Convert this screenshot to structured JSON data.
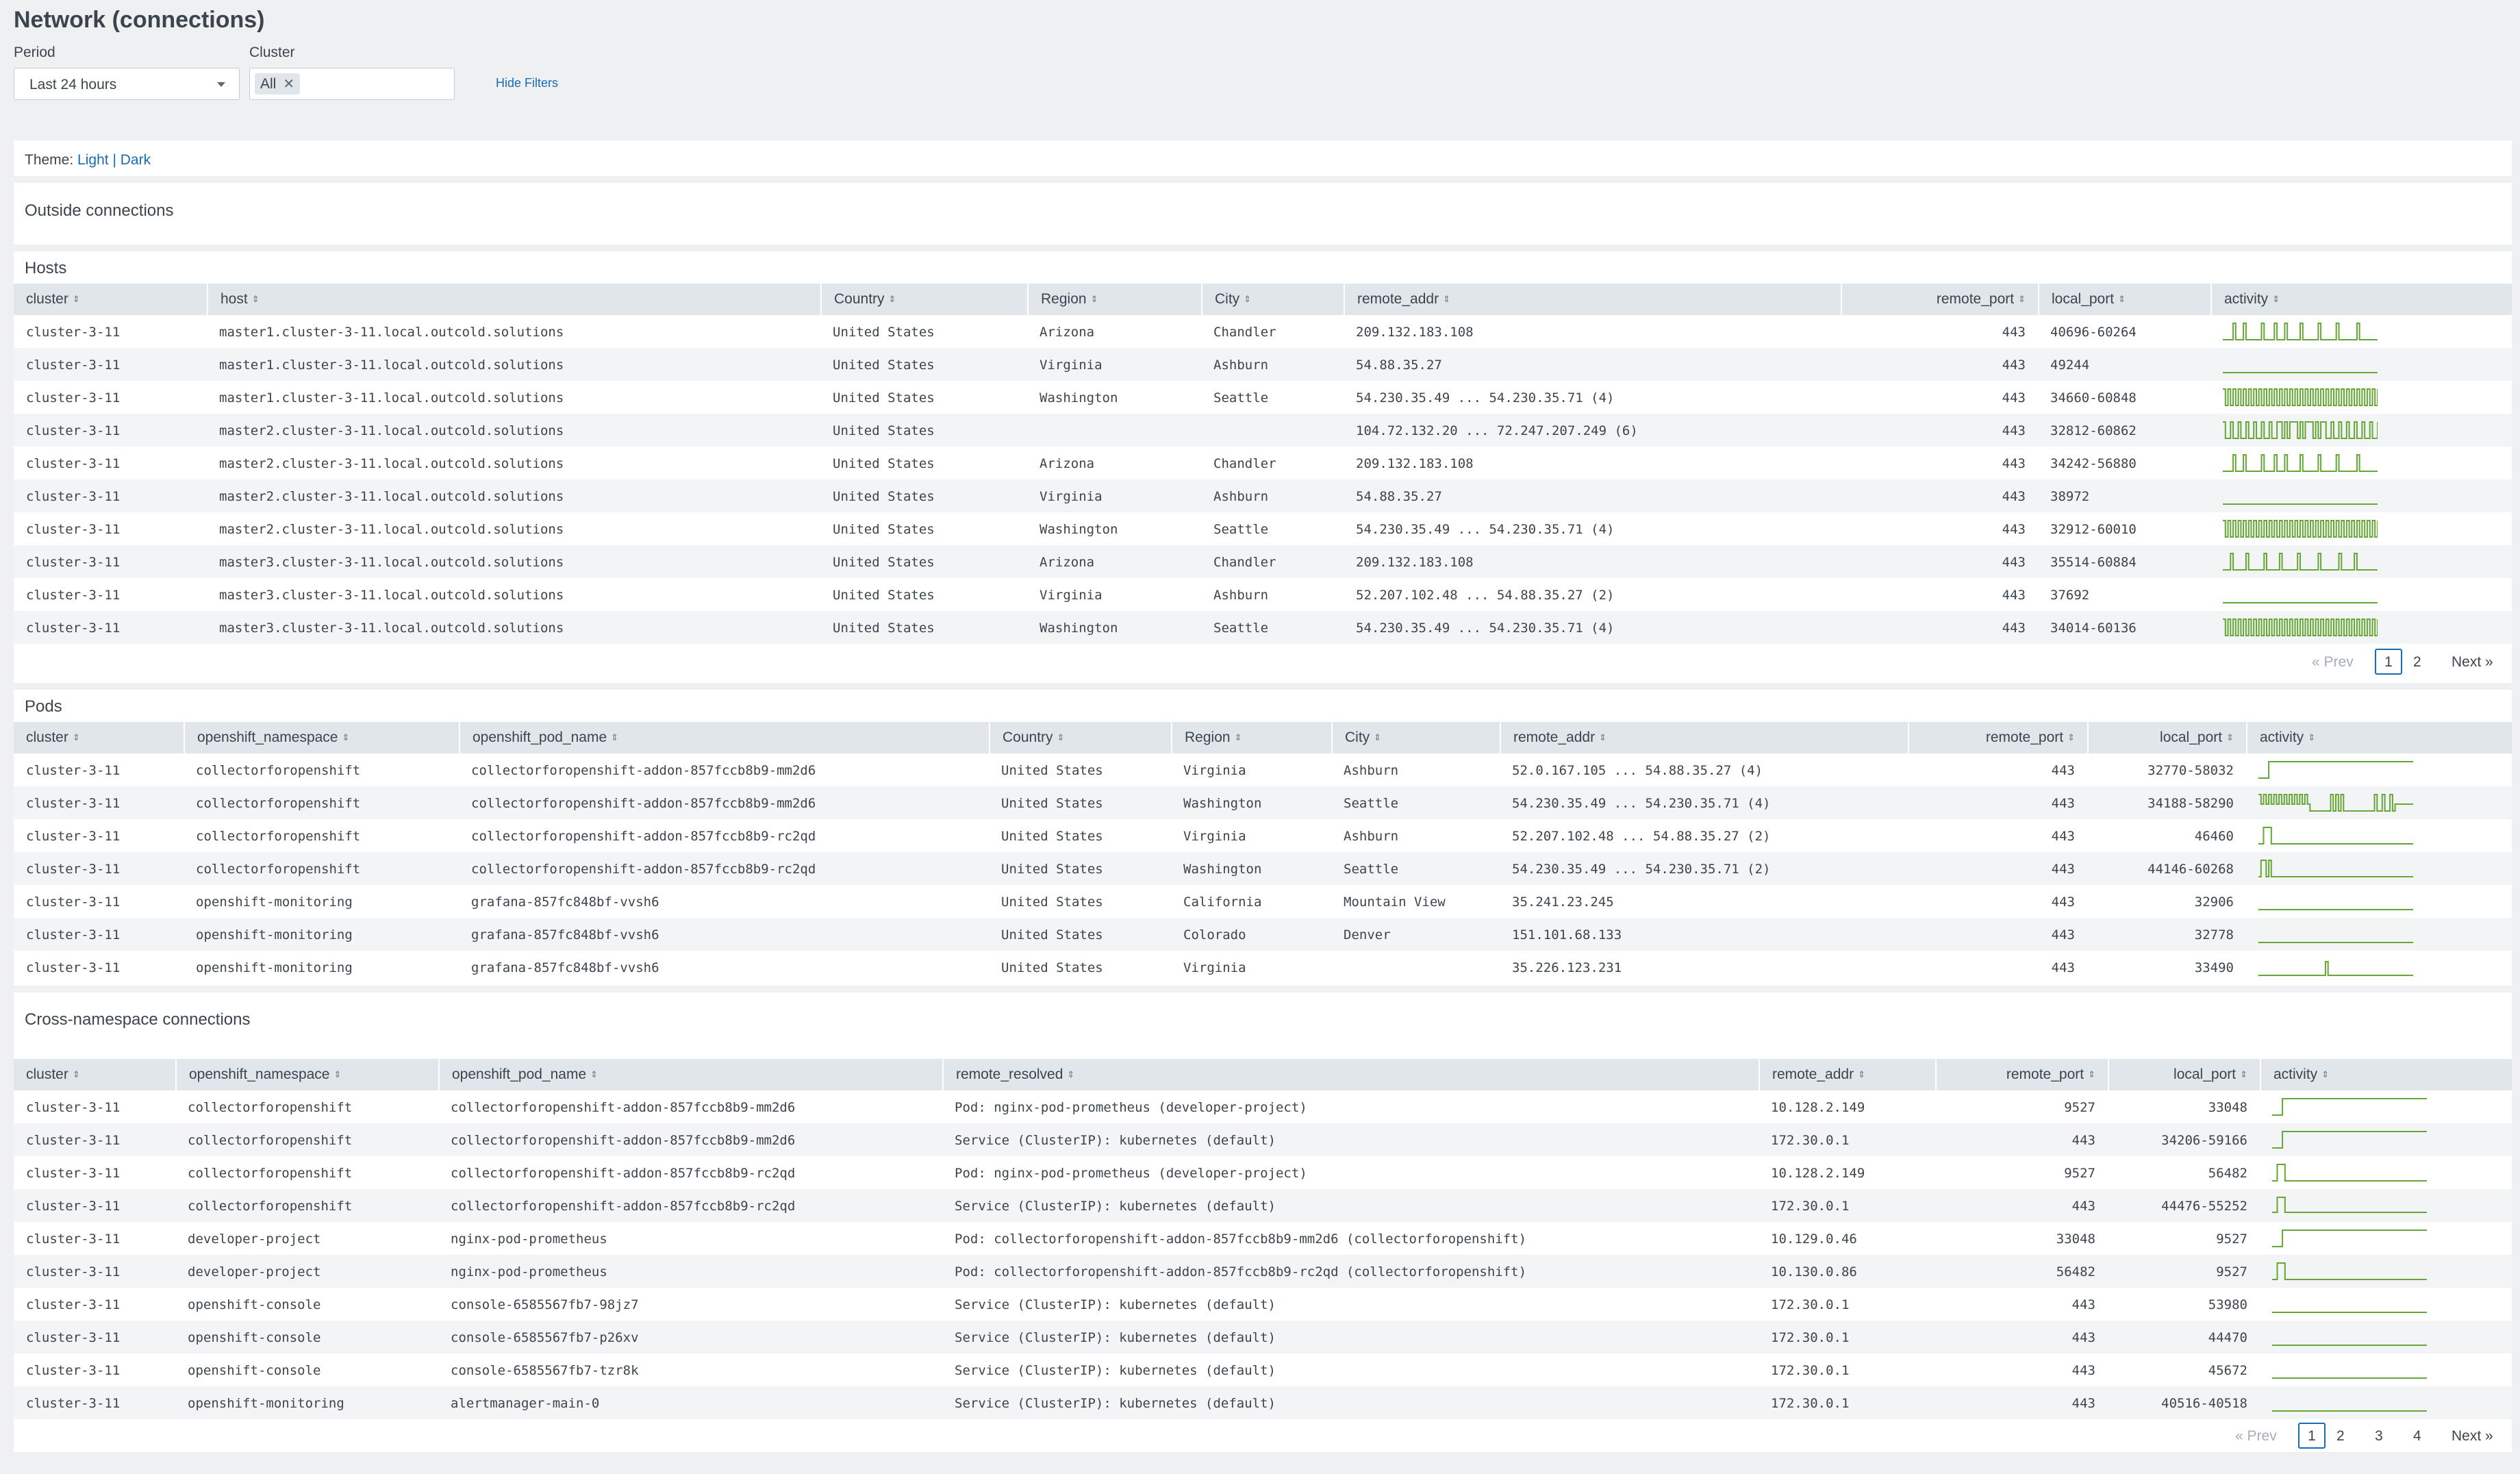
{
  "page_title": "Network (connections)",
  "filters": {
    "period_label": "Period",
    "period_value": "Last 24 hours",
    "cluster_label": "Cluster",
    "cluster_chip": "All",
    "hide_filters": "Hide Filters"
  },
  "theme": {
    "label": "Theme:",
    "light": "Light",
    "separator": "|",
    "dark": "Dark"
  },
  "outside_title": "Outside connections",
  "colors": {
    "accent": "#1a6bb0",
    "sparkline": "#65a637",
    "header_bg": "#e1e6eb"
  },
  "hosts": {
    "title": "Hosts",
    "columns": [
      "cluster",
      "host",
      "Country",
      "Region",
      "City",
      "remote_addr",
      "remote_port",
      "local_port",
      "activity"
    ],
    "rows": [
      [
        "cluster-3-11",
        "master1.cluster-3-11.local.outcold.solutions",
        "United States",
        "Arizona",
        "Chandler",
        "209.132.183.108",
        "443",
        "40696-60264"
      ],
      [
        "cluster-3-11",
        "master1.cluster-3-11.local.outcold.solutions",
        "United States",
        "Virginia",
        "Ashburn",
        "54.88.35.27",
        "443",
        "49244"
      ],
      [
        "cluster-3-11",
        "master1.cluster-3-11.local.outcold.solutions",
        "United States",
        "Washington",
        "Seattle",
        "54.230.35.49 ... 54.230.35.71 (4)",
        "443",
        "34660-60848"
      ],
      [
        "cluster-3-11",
        "master2.cluster-3-11.local.outcold.solutions",
        "United States",
        "",
        "",
        "104.72.132.20 ... 72.247.207.249 (6)",
        "443",
        "32812-60862"
      ],
      [
        "cluster-3-11",
        "master2.cluster-3-11.local.outcold.solutions",
        "United States",
        "Arizona",
        "Chandler",
        "209.132.183.108",
        "443",
        "34242-56880"
      ],
      [
        "cluster-3-11",
        "master2.cluster-3-11.local.outcold.solutions",
        "United States",
        "Virginia",
        "Ashburn",
        "54.88.35.27",
        "443",
        "38972"
      ],
      [
        "cluster-3-11",
        "master2.cluster-3-11.local.outcold.solutions",
        "United States",
        "Washington",
        "Seattle",
        "54.230.35.49 ... 54.230.35.71 (4)",
        "443",
        "32912-60010"
      ],
      [
        "cluster-3-11",
        "master3.cluster-3-11.local.outcold.solutions",
        "United States",
        "Arizona",
        "Chandler",
        "209.132.183.108",
        "443",
        "35514-60884"
      ],
      [
        "cluster-3-11",
        "master3.cluster-3-11.local.outcold.solutions",
        "United States",
        "Virginia",
        "Ashburn",
        "52.207.102.48 ... 54.88.35.27 (2)",
        "443",
        "37692"
      ],
      [
        "cluster-3-11",
        "master3.cluster-3-11.local.outcold.solutions",
        "United States",
        "Washington",
        "Seattle",
        "54.230.35.49 ... 54.230.35.71 (4)",
        "443",
        "34014-60136"
      ]
    ],
    "activity": [
      "pulses",
      "flat",
      "dense",
      "sparse",
      "pulses",
      "flat",
      "dense",
      "pulses2",
      "flat",
      "dense"
    ],
    "pager": {
      "prev": "« Prev",
      "pages": [
        "1",
        "2"
      ],
      "current": "1",
      "next": "Next »"
    }
  },
  "pods": {
    "title": "Pods",
    "columns": [
      "cluster",
      "openshift_namespace",
      "openshift_pod_name",
      "Country",
      "Region",
      "City",
      "remote_addr",
      "remote_port",
      "local_port",
      "activity"
    ],
    "rows": [
      [
        "cluster-3-11",
        "collectorforopenshift",
        "collectorforopenshift-addon-857fccb8b9-mm2d6",
        "United States",
        "Virginia",
        "Ashburn",
        "52.0.167.105 ... 54.88.35.27 (4)",
        "443",
        "32770-58032"
      ],
      [
        "cluster-3-11",
        "collectorforopenshift",
        "collectorforopenshift-addon-857fccb8b9-mm2d6",
        "United States",
        "Washington",
        "Seattle",
        "54.230.35.49 ... 54.230.35.71 (4)",
        "443",
        "34188-58290"
      ],
      [
        "cluster-3-11",
        "collectorforopenshift",
        "collectorforopenshift-addon-857fccb8b9-rc2qd",
        "United States",
        "Virginia",
        "Ashburn",
        "52.207.102.48 ... 54.88.35.27 (2)",
        "443",
        "46460"
      ],
      [
        "cluster-3-11",
        "collectorforopenshift",
        "collectorforopenshift-addon-857fccb8b9-rc2qd",
        "United States",
        "Washington",
        "Seattle",
        "54.230.35.49 ... 54.230.35.71 (2)",
        "443",
        "44146-60268"
      ],
      [
        "cluster-3-11",
        "openshift-monitoring",
        "grafana-857fc848bf-vvsh6",
        "United States",
        "California",
        "Mountain View",
        "35.241.23.245",
        "443",
        "32906"
      ],
      [
        "cluster-3-11",
        "openshift-monitoring",
        "grafana-857fc848bf-vvsh6",
        "United States",
        "Colorado",
        "Denver",
        "151.101.68.133",
        "443",
        "32778"
      ],
      [
        "cluster-3-11",
        "openshift-monitoring",
        "grafana-857fc848bf-vvsh6",
        "United States",
        "Virginia",
        "",
        "35.226.123.231",
        "443",
        "33490"
      ]
    ],
    "activity": [
      "step",
      "bursty",
      "bump",
      "early",
      "flat",
      "flat",
      "spike"
    ]
  },
  "cross": {
    "title": "Cross-namespace connections",
    "columns": [
      "cluster",
      "openshift_namespace",
      "openshift_pod_name",
      "remote_resolved",
      "remote_addr",
      "remote_port",
      "local_port",
      "activity"
    ],
    "rows": [
      [
        "cluster-3-11",
        "collectorforopenshift",
        "collectorforopenshift-addon-857fccb8b9-mm2d6",
        "Pod: nginx-pod-prometheus (developer-project)",
        "10.128.2.149",
        "9527",
        "33048"
      ],
      [
        "cluster-3-11",
        "collectorforopenshift",
        "collectorforopenshift-addon-857fccb8b9-mm2d6",
        "Service (ClusterIP): kubernetes (default)",
        "172.30.0.1",
        "443",
        "34206-59166"
      ],
      [
        "cluster-3-11",
        "collectorforopenshift",
        "collectorforopenshift-addon-857fccb8b9-rc2qd",
        "Pod: nginx-pod-prometheus (developer-project)",
        "10.128.2.149",
        "9527",
        "56482"
      ],
      [
        "cluster-3-11",
        "collectorforopenshift",
        "collectorforopenshift-addon-857fccb8b9-rc2qd",
        "Service (ClusterIP): kubernetes (default)",
        "172.30.0.1",
        "443",
        "44476-55252"
      ],
      [
        "cluster-3-11",
        "developer-project",
        "nginx-pod-prometheus",
        "Pod: collectorforopenshift-addon-857fccb8b9-mm2d6 (collectorforopenshift)",
        "10.129.0.46",
        "33048",
        "9527"
      ],
      [
        "cluster-3-11",
        "developer-project",
        "nginx-pod-prometheus",
        "Pod: collectorforopenshift-addon-857fccb8b9-rc2qd (collectorforopenshift)",
        "10.130.0.86",
        "56482",
        "9527"
      ],
      [
        "cluster-3-11",
        "openshift-console",
        "console-6585567fb7-98jz7",
        "Service (ClusterIP): kubernetes (default)",
        "172.30.0.1",
        "443",
        "53980"
      ],
      [
        "cluster-3-11",
        "openshift-console",
        "console-6585567fb7-p26xv",
        "Service (ClusterIP): kubernetes (default)",
        "172.30.0.1",
        "443",
        "44470"
      ],
      [
        "cluster-3-11",
        "openshift-console",
        "console-6585567fb7-tzr8k",
        "Service (ClusterIP): kubernetes (default)",
        "172.30.0.1",
        "443",
        "45672"
      ],
      [
        "cluster-3-11",
        "openshift-monitoring",
        "alertmanager-main-0",
        "Service (ClusterIP): kubernetes (default)",
        "172.30.0.1",
        "443",
        "40516-40518"
      ]
    ],
    "activity": [
      "step",
      "step",
      "bump",
      "drop",
      "step",
      "bump",
      "flat",
      "flat",
      "flat",
      "flat"
    ],
    "pager": {
      "prev": "« Prev",
      "pages": [
        "1",
        "2",
        "3",
        "4"
      ],
      "current": "1",
      "next": "Next »"
    }
  }
}
